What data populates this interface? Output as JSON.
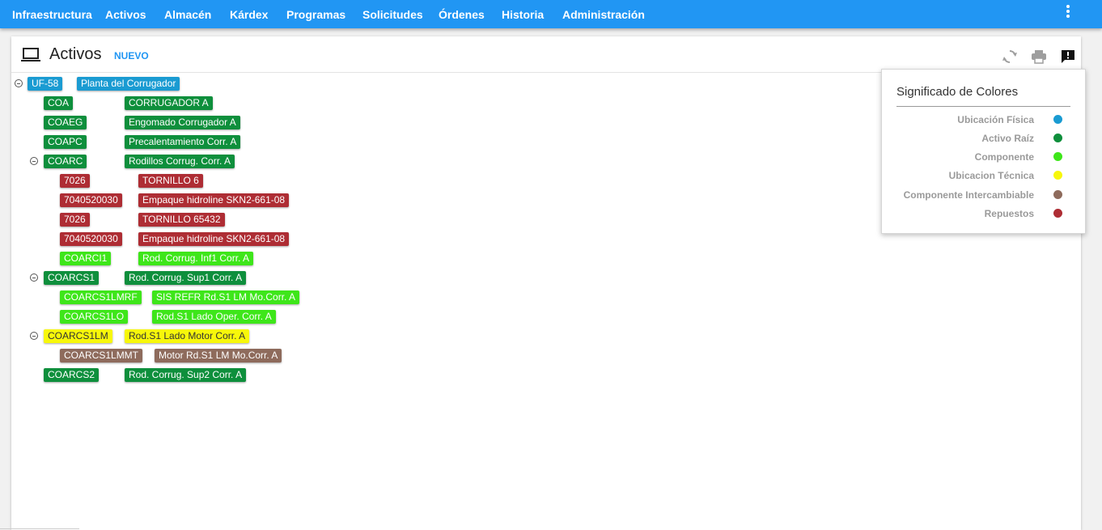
{
  "nav": {
    "items": [
      "Infraestructura",
      "Activos",
      "Almacén",
      "Kárdex",
      "Programas",
      "Solicitudes",
      "Órdenes",
      "Historia",
      "Administración"
    ],
    "more_icon": "vertical-dots-icon"
  },
  "header": {
    "icon": "laptop-icon",
    "title": "Activos",
    "new_label": "NUEVO",
    "actions": [
      "refresh-icon",
      "print-icon",
      "feedback-icon"
    ]
  },
  "colors": {
    "ubicacion_fisica": "#1a9bd2",
    "activo_raiz": "#0e8f3c",
    "componente": "#3ee61a",
    "ubicacion_tecnica": "#f7f70a",
    "componente_intercambiable": "#8e6b5c",
    "repuestos": "#ae2d34"
  },
  "tree": [
    {
      "code": "UF-58",
      "name": "Planta del Corrugador",
      "type": "ubicacion_fisica",
      "expanded": true
    },
    {
      "code": "COA",
      "name": "CORRUGADOR A",
      "type": "activo_raiz"
    },
    {
      "code": "COAEG",
      "name": "Engomado Corrugador A",
      "type": "activo_raiz"
    },
    {
      "code": "COAPC",
      "name": "Precalentamiento Corr. A",
      "type": "activo_raiz"
    },
    {
      "code": "COARC",
      "name": "Rodillos Corrug. Corr. A",
      "type": "activo_raiz",
      "expanded": true
    },
    {
      "code": "7026",
      "name": "TORNILLO 6",
      "type": "repuestos"
    },
    {
      "code": "7040520030",
      "name": "Empaque hidroline SKN2-661-08",
      "type": "repuestos"
    },
    {
      "code": "7026",
      "name": "TORNILLO 65432",
      "type": "repuestos"
    },
    {
      "code": "7040520030",
      "name": "Empaque hidroline SKN2-661-08",
      "type": "repuestos"
    },
    {
      "code": "COARCI1",
      "name": "Rod. Corrug. Inf1 Corr. A",
      "type": "componente"
    },
    {
      "code": "COARCS1",
      "name": "Rod. Corrug. Sup1 Corr. A",
      "type": "activo_raiz",
      "expanded": true
    },
    {
      "code": "COARCS1LMRF",
      "name": "SIS REFR Rd.S1 LM Mo.Corr. A",
      "type": "componente"
    },
    {
      "code": "COARCS1LO",
      "name": "Rod.S1 Lado Oper. Corr. A",
      "type": "componente"
    },
    {
      "code": "COARCS1LM",
      "name": "Rod.S1 Lado Motor Corr. A",
      "type": "ubicacion_tecnica",
      "expanded": true
    },
    {
      "code": "COARCS1LMMT",
      "name": "Motor Rd.S1 LM Mo.Corr. A",
      "type": "componente_intercambiable"
    },
    {
      "code": "COARCS2",
      "name": "Rod. Corrug. Sup2 Corr. A",
      "type": "activo_raiz"
    }
  ],
  "legend": {
    "title": "Significado de Colores",
    "items": [
      {
        "label": "Ubicación Física",
        "color": "#1a9bd2"
      },
      {
        "label": "Activo Raíz",
        "color": "#0e8f3c"
      },
      {
        "label": "Componente",
        "color": "#3ee61a"
      },
      {
        "label": "Ubicacion Técnica",
        "color": "#f7f70a"
      },
      {
        "label": "Componente Intercambiable",
        "color": "#8e6b5c"
      },
      {
        "label": "Repuestos",
        "color": "#ae2d34"
      }
    ]
  }
}
